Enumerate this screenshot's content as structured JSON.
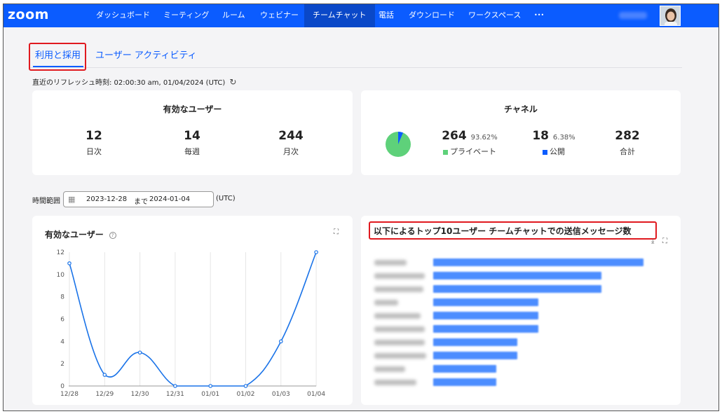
{
  "app": {
    "logo": "zoom"
  },
  "nav": {
    "items": [
      "ダッシュボード",
      "ミーティング",
      "ルーム",
      "ウェビナー",
      "チームチャット",
      "電話",
      "ダウンロード",
      "ワークスペース",
      "•••"
    ],
    "active_index": 4
  },
  "tabs": {
    "usage": "利用と採用",
    "activity": "ユーザー アクティビティ"
  },
  "refresh": {
    "text": "直近のリフレッシュ時刻: 02:00:30 am, 01/04/2024 (UTC)",
    "icon": "refresh-icon"
  },
  "active_users": {
    "title": "有効なユーザー",
    "daily": {
      "value": "12",
      "label": "日次"
    },
    "weekly": {
      "value": "14",
      "label": "毎週"
    },
    "monthly": {
      "value": "244",
      "label": "月次"
    }
  },
  "channels": {
    "title": "チャネル",
    "private": {
      "value": "264",
      "pct": "93.62%",
      "label": "プライベート",
      "color": "#5ed17a"
    },
    "public": {
      "value": "18",
      "pct": "6.38%",
      "label": "公開",
      "color": "#0b5cff"
    },
    "total": {
      "value": "282",
      "label": "合計"
    }
  },
  "time_range": {
    "label": "時間範囲",
    "from": "2023-12-28",
    "to_word": "まで",
    "to": "2024-01-04",
    "tz": "(UTC)"
  },
  "line_chart": {
    "title": "有効なユーザー",
    "help": "?"
  },
  "bar_chart": {
    "title": "以下によるトップ10ユーザー チームチャットでの送信メッセージ数"
  },
  "colors": {
    "brand": "#0b5cff",
    "highlight": "#e0191f",
    "line": "#1a73e8",
    "bar": "#4c8dff"
  },
  "chart_data": [
    {
      "type": "line",
      "title": "有効なユーザー",
      "x": [
        "12/28",
        "12/29",
        "12/30",
        "12/31",
        "01/01",
        "01/02",
        "01/03",
        "01/04"
      ],
      "values": [
        11,
        1,
        3,
        0,
        0,
        0,
        4,
        12
      ],
      "ylim": [
        0,
        12
      ],
      "yticks": [
        0,
        2,
        4,
        6,
        8,
        10,
        12
      ],
      "grid": "vertical"
    },
    {
      "type": "bar",
      "orientation": "horizontal",
      "title": "以下によるトップ10ユーザー チームチャットでの送信メッセージ数",
      "values": [
        100,
        80,
        80,
        50,
        50,
        50,
        40,
        40,
        30,
        30
      ]
    }
  ]
}
